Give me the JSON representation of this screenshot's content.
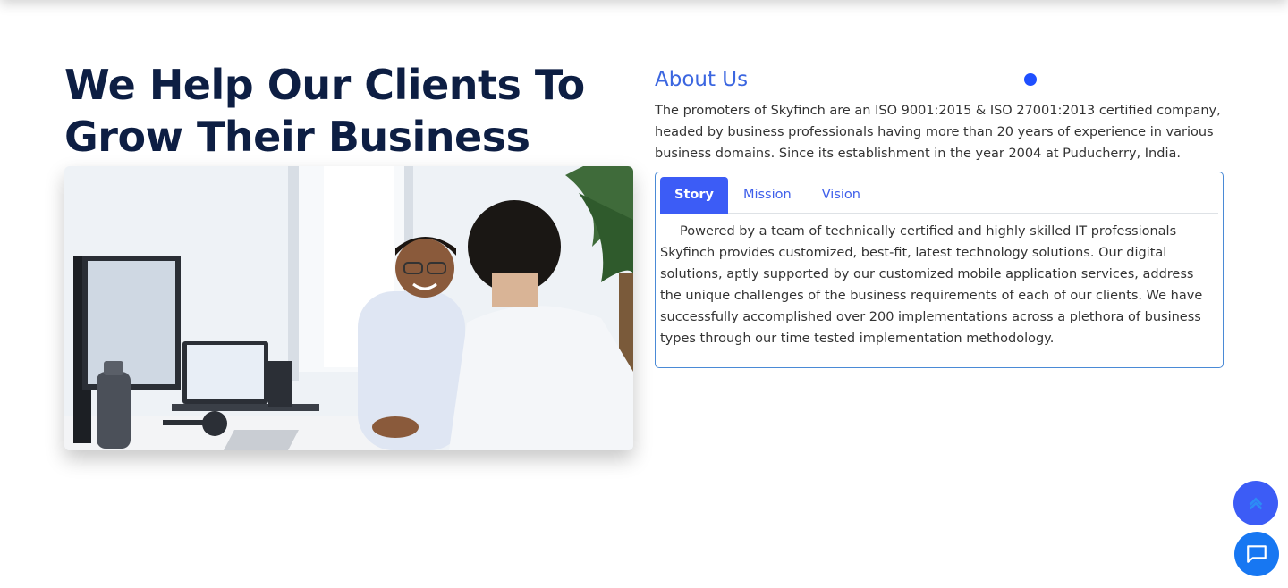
{
  "hero": {
    "heading_line1": "We Help Our Clients To",
    "heading_line2": "Grow Their Business",
    "photo_alt": "Two professionals in a meeting at an office desk"
  },
  "about": {
    "title": "About Us",
    "text": "The promoters of Skyfinch are an ISO 9001:2015 & ISO 27001:2013 certified company, headed by business professionals having more than 20 years of experience in various business domains. Since its establishment in the year 2004 at Puducherry, India."
  },
  "tabs": {
    "items": [
      {
        "label": "Story",
        "active": true
      },
      {
        "label": "Mission",
        "active": false
      },
      {
        "label": "Vision",
        "active": false
      }
    ],
    "active_content": "Powered by a team of technically certified and highly skilled IT professionals Skyfinch provides customized, best-fit, latest technology solutions. Our digital solutions, aptly supported by our customized mobile application services, address the unique challenges of the business requirements of each of our clients. We have successfully accomplished over 200 implementations across a plethora of business types through our time tested implementation methodology."
  },
  "floating": {
    "scroll_top_icon": "chevron-up-icon",
    "chat_icon": "chat-bubble-icon"
  },
  "colors": {
    "heading": "#0d1e43",
    "accent": "#3b66e0",
    "tab_active": "#3c5cf6",
    "chat_button": "#1777f2"
  }
}
